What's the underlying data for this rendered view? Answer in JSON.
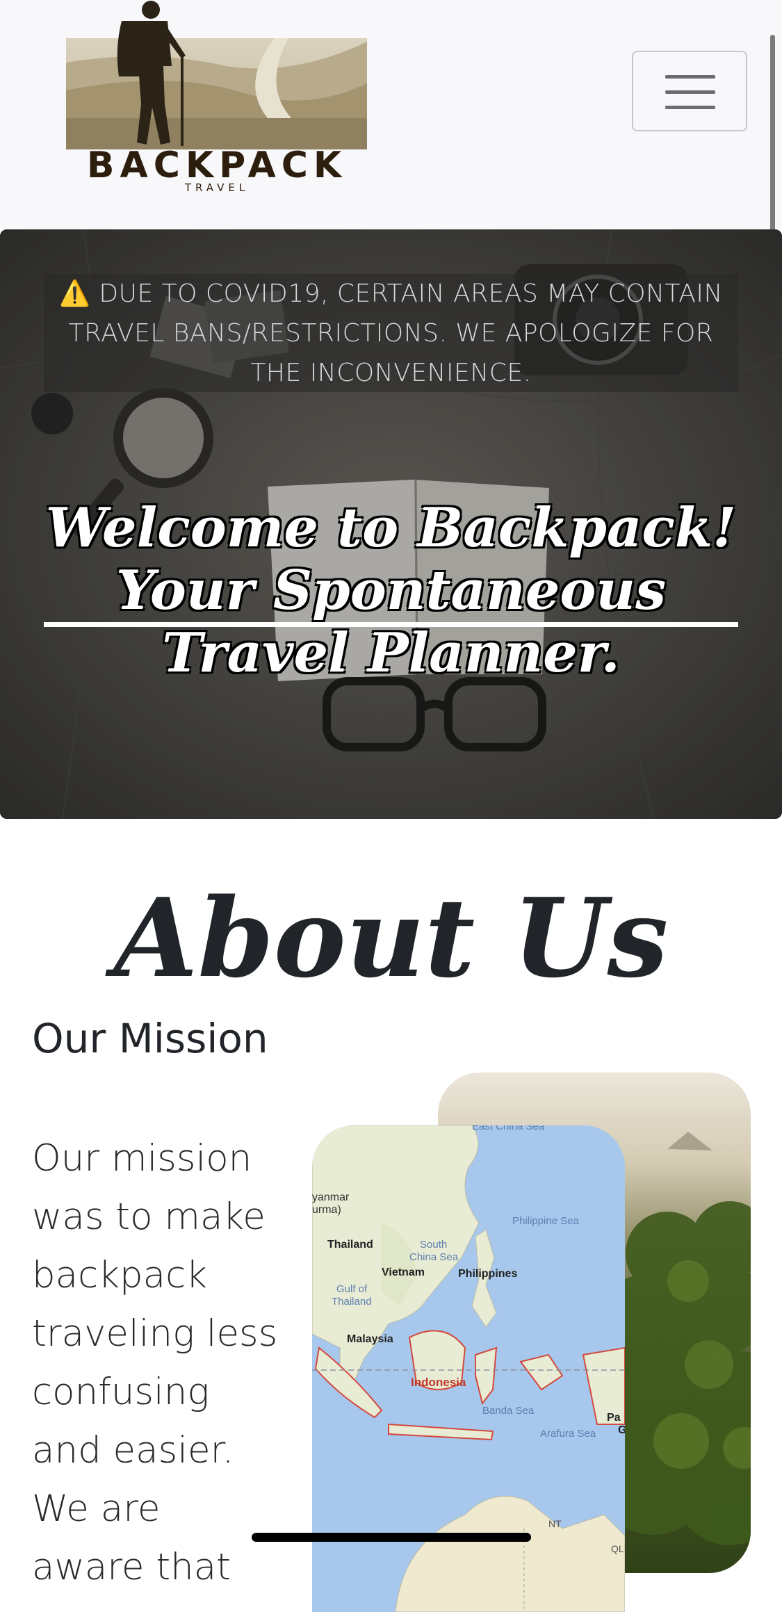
{
  "brand": {
    "name": "BACKPACK",
    "tagline": "TRAVEL"
  },
  "hero": {
    "notice_icon": "⚠️",
    "notice": "DUE TO COVID19, CERTAIN AREAS MAY CONTAIN TRAVEL BANS/RESTRICTIONS. WE APOLOGIZE FOR THE INCONVENIENCE.",
    "welcome": "Welcome to Backpack! Your Spontaneous Travel Planner."
  },
  "about": {
    "title": "About Us",
    "mission_title": "Our Mission",
    "mission_text": "Our mission was to make backpack traveling less confusing and easier. We are aware that"
  },
  "map": {
    "labels": [
      "East China Sea",
      "yanmar",
      "urma)",
      "Philippine Sea",
      "South",
      "China Sea",
      "Thailand",
      "Vietnam",
      "Philippines",
      "Gulf of",
      "Thailand",
      "Malaysia",
      "Indonesia",
      "Banda Sea",
      "Arafura Sea",
      "Pa",
      "G",
      "NT",
      "QLI"
    ]
  },
  "colors": {
    "navbar_bg": "#f8f8fa",
    "hero_overlay": "#3b3a37",
    "text_dark": "#212529",
    "warning": "#e7b622",
    "map_sea": "#a7c8ec",
    "map_land": "#e8ecd4"
  }
}
